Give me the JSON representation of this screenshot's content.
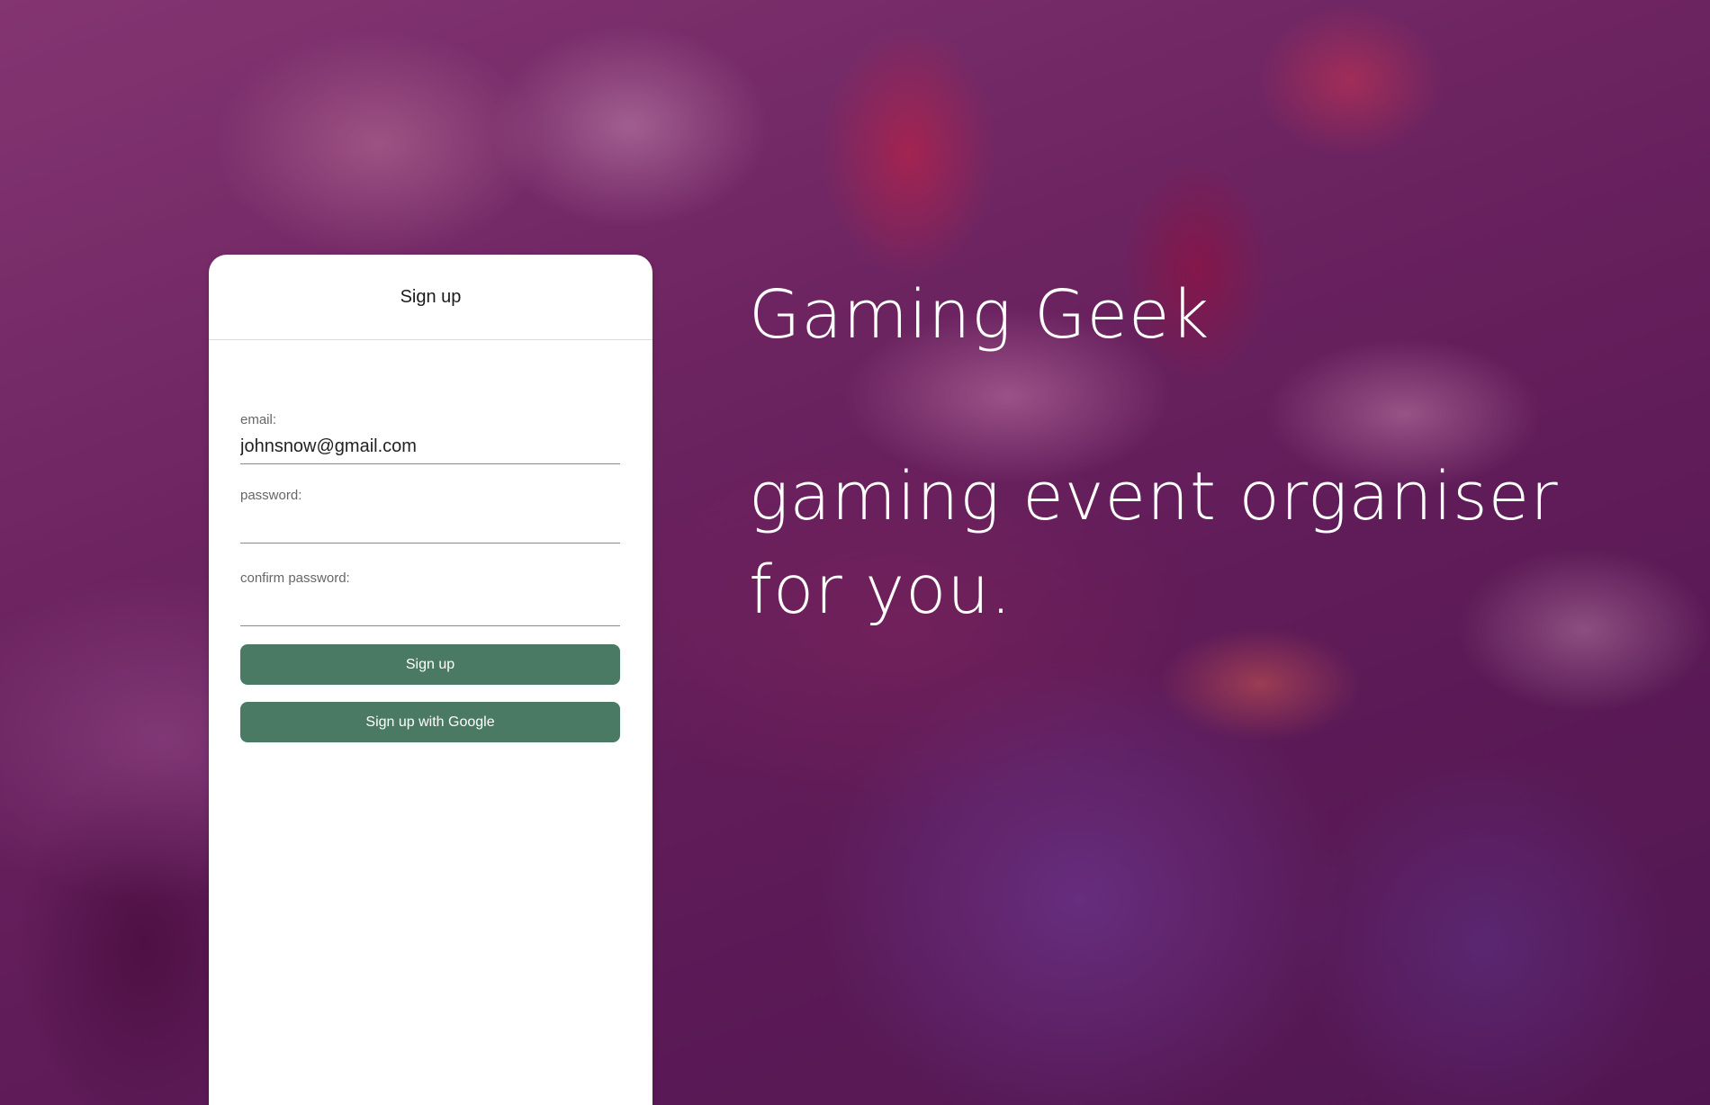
{
  "hero": {
    "title": "Gaming Geek",
    "tagline_line1": "gaming event organiser",
    "tagline_line2": "for you."
  },
  "signup_card": {
    "title": "Sign up",
    "email": {
      "label": "email:",
      "value": "johnsnow@gmail.com"
    },
    "password": {
      "label": "password:",
      "value": ""
    },
    "confirm_password": {
      "label": "confirm password:",
      "value": ""
    },
    "signup_button_label": "Sign up",
    "google_button_label": "Sign up with Google"
  },
  "colors": {
    "button_green": "#4a7a63",
    "overlay_purple": "#5a1c4e",
    "card_background": "#ffffff"
  }
}
